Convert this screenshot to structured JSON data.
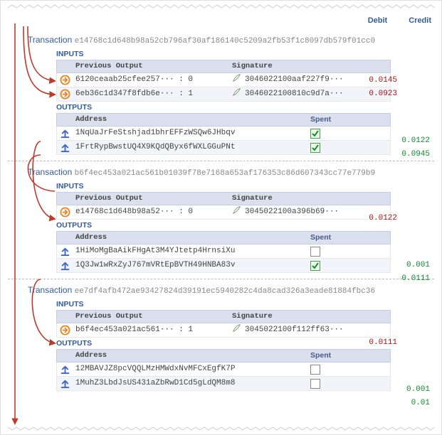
{
  "columns": {
    "debit": "Debit",
    "credit": "Credit"
  },
  "labels": {
    "transaction": "Transaction",
    "inputs": "INPUTS",
    "outputs": "OUTPUTS",
    "prev_output": "Previous Output",
    "signature": "Signature",
    "address": "Address",
    "spent": "Spent"
  },
  "txns": [
    {
      "hash": "e14768c1d648b98a52cb796af30af186140c5209a2fb53f1c8097db579f01cc0",
      "inputs": [
        {
          "prev": "6120ceaab25cfee257··· : 0",
          "sig": "3046022100aaf227f9···",
          "debit": "0.0145"
        },
        {
          "prev": "6eb36c1d347f8fdb6e··· : 1",
          "sig": "3046022100810c9d7a···",
          "debit": "0.0923"
        }
      ],
      "outputs": [
        {
          "addr": "1NqUaJrFeStshjad1bhrEFFzWSQw6JHbqv",
          "spent": true,
          "credit": "0.0122"
        },
        {
          "addr": "1FrtRypBwstUQ4X9KQdQByx6fWXLGGuPNt",
          "spent": true,
          "credit": "0.0945"
        }
      ]
    },
    {
      "hash": "b6f4ec453a021ac561b01039f78e7168a653af176353c86d607343cc77e779b9",
      "inputs": [
        {
          "prev": "e14768c1d648b98a52··· : 0",
          "sig": "3045022100a396b69···",
          "debit": "0.0122"
        }
      ],
      "outputs": [
        {
          "addr": "1HiMoMgBaAikFHgAt3M4YJtetp4HrnsiXu",
          "spent": false,
          "credit": "0.001"
        },
        {
          "addr": "1Q3Jw1wRxZyJ767mVRtEpBVTH49HNBA83v",
          "spent": true,
          "credit": "0.0111"
        }
      ]
    },
    {
      "hash": "ee7df4afb472ae93427824d39191ec5940282c4da8cad326a3eade81884fbc36",
      "inputs": [
        {
          "prev": "b6f4ec453a021ac561··· : 1",
          "sig": "3045022100f112ff63···",
          "debit": "0.0111"
        }
      ],
      "outputs": [
        {
          "addr": "12MBAVJZ8pcVQQLMzHMWdxNvMFCxEgfK7P",
          "spent": false,
          "credit": "0.001"
        },
        {
          "addr": "1MuhZ3LbdJsUS431aZbRwD1Cd5gLdQM8m8",
          "spent": false,
          "credit": "0.01"
        }
      ]
    }
  ]
}
